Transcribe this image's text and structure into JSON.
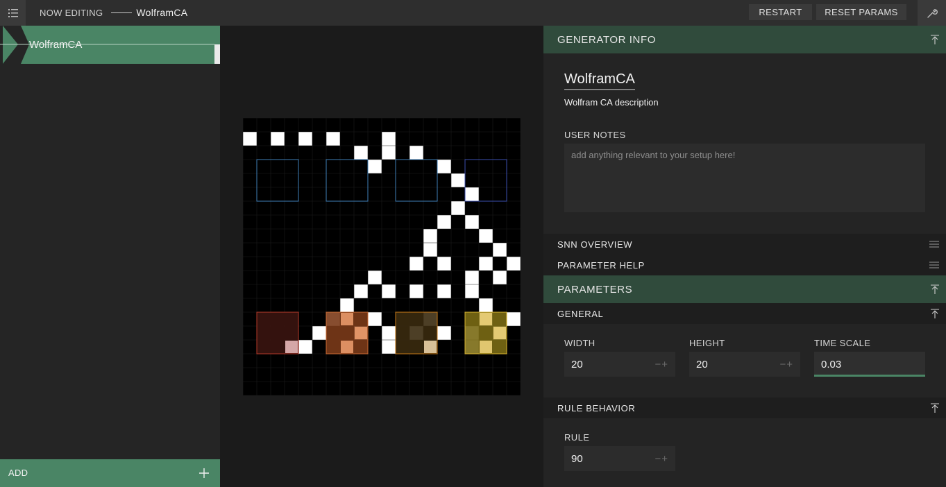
{
  "header": {
    "now_editing_label": "NOW EDITING",
    "current_generator": "WolframCA",
    "restart_label": "RESTART",
    "reset_params_label": "RESET PARAMS",
    "menu_icon": "hamburger-menu-icon",
    "settings_icon": "wrench-icon"
  },
  "sidebar": {
    "items": [
      {
        "label": "WolframCA",
        "selected": true
      }
    ],
    "add_label": "ADD",
    "add_icon": "plus-icon"
  },
  "canvas": {
    "grid_width": 20,
    "grid_height": 20,
    "rows": [
      "00000000000000000000",
      "10101010001000000000",
      "00000000101010000000",
      "00000000010000100000",
      "00000000000000010000",
      "00000000000000001000",
      "00000000000000010000",
      "00000000000000101000",
      "00000000000001000100",
      "00000000000001000010",
      "00000000000010100101",
      "00000000010000001010",
      "00000000101010101000",
      "00000001000000000100",
      "00000010010001000101",
      "00000100101010101010",
      "00001000001000001000",
      "00000000000000000000",
      "00000000000000000000",
      "00000000000000000000"
    ],
    "region_boxes": [
      {
        "color": "#3f7fb8"
      },
      {
        "color": "#3f7fb8"
      },
      {
        "color": "#3f7fb8"
      },
      {
        "color": "#3c4fb0"
      }
    ],
    "output_boxes": [
      {
        "fill": "#3a1410",
        "border": "#b33a2a"
      },
      {
        "fill": "#7a3a18",
        "border": "#c86a34"
      },
      {
        "fill": "#3a2a0e",
        "border": "#c87a18"
      },
      {
        "fill": "#7a6a14",
        "border": "#d8b430"
      }
    ]
  },
  "generator_info": {
    "section_title": "GENERATOR INFO",
    "name": "WolframCA",
    "description": "Wolfram CA description",
    "user_notes_label": "USER NOTES",
    "user_notes_placeholder": "add anything relevant to your setup here!",
    "collapse_icon": "collapse-up-icon"
  },
  "snn_overview": {
    "title": "SNN OVERVIEW",
    "icon": "drag-handle-icon"
  },
  "parameter_help": {
    "title": "PARAMETER HELP",
    "icon": "drag-handle-icon"
  },
  "parameters": {
    "section_title": "PARAMETERS",
    "general": {
      "title": "GENERAL",
      "fields": [
        {
          "label": "WIDTH",
          "value": "20",
          "stepper": "−+"
        },
        {
          "label": "HEIGHT",
          "value": "20",
          "stepper": "−+"
        },
        {
          "label": "TIME SCALE",
          "value": "0.03"
        }
      ]
    },
    "rule_behavior": {
      "title": "RULE BEHAVIOR",
      "fields": [
        {
          "label": "RULE",
          "value": "90",
          "stepper": "−+"
        }
      ]
    }
  },
  "colors": {
    "accent": "#4a8565",
    "accent_dark": "#304b3c"
  }
}
